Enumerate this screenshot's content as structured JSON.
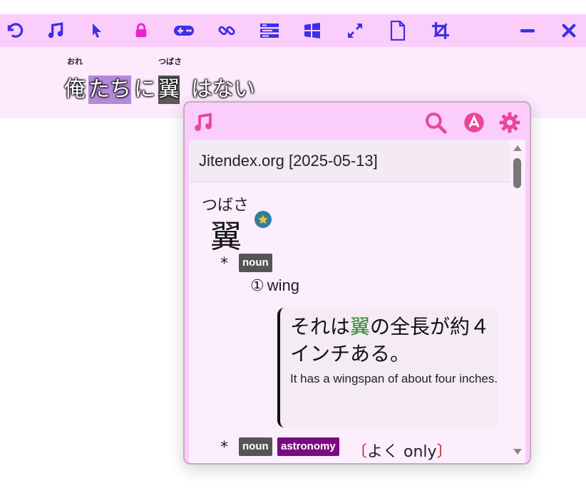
{
  "toolbar": {
    "icons": [
      "undo-icon",
      "music-note-icon",
      "cursor-icon",
      "lock-icon",
      "gamepad-icon",
      "link-icon",
      "layout-rows-icon",
      "windows-icon",
      "expand-icon",
      "file-icon",
      "crop-icon",
      "minimize-icon",
      "close-icon"
    ],
    "colors": {
      "accent": "#3d2fe6",
      "lock": "#ee22cc",
      "background": "#fbcdfb"
    }
  },
  "subtitle": {
    "segments": [
      {
        "text": "俺",
        "ruby": "おれ",
        "highlight": "none"
      },
      {
        "text": "たち",
        "ruby": "",
        "highlight": "purple"
      },
      {
        "text": "に",
        "ruby": "",
        "highlight": "none"
      },
      {
        "text": "翼",
        "ruby": "つばさ",
        "highlight": "dark"
      },
      {
        "text": "はない",
        "ruby": "",
        "highlight": "none"
      }
    ]
  },
  "popup": {
    "icons": [
      "music-note-icon",
      "search-icon",
      "anki-icon",
      "gear-icon"
    ],
    "accent": "#e8479a",
    "dictionary": "Jitendex.org [2025-05-13]",
    "entry": {
      "reading": "つばさ",
      "headword": "翼",
      "bullet": "*",
      "senses": [
        {
          "tags": [
            "noun"
          ],
          "number": "①",
          "gloss": "wing",
          "example": {
            "jp_before": "それは",
            "jp_highlight": "翼",
            "jp_after": "の全長が約４インチある。",
            "en": "It has a wingspan of about four inches."
          }
        },
        {
          "tags": [
            "noun",
            "astronomy"
          ],
          "note_open": "〔",
          "note_text": "よく only",
          "note_close": "〕"
        }
      ]
    }
  }
}
